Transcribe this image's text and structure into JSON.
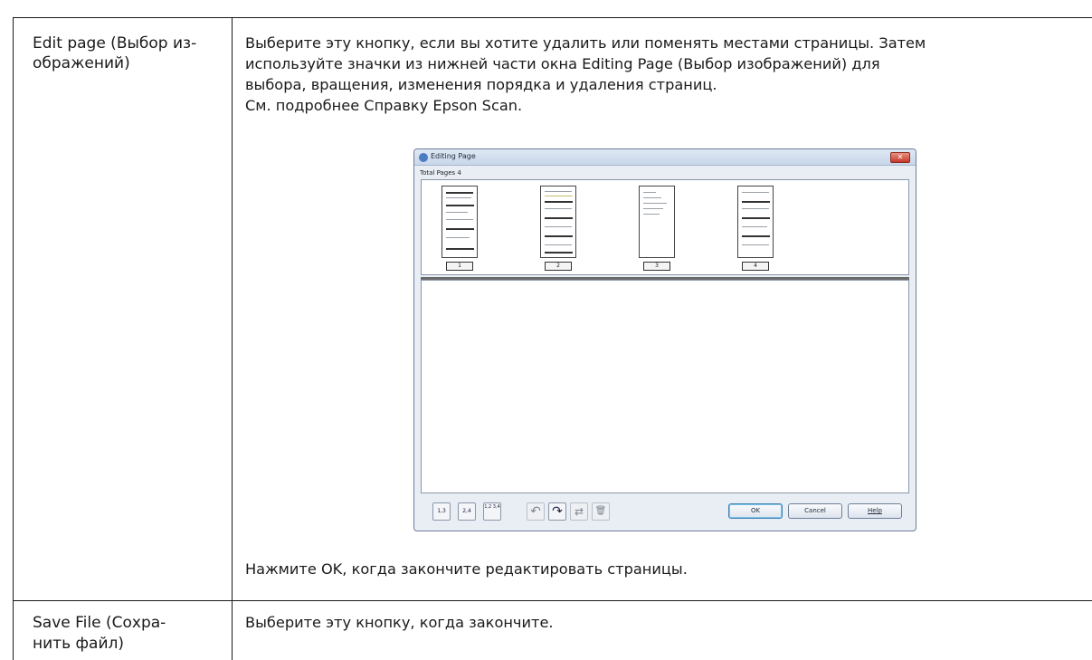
{
  "rows": [
    {
      "left_line1": "Edit page (Выбор из-",
      "left_line2": "ображений)",
      "right_lines": [
        "Выберите эту кнопку, если вы хотите удалить или поменять местами страницы. Затем",
        "используйте значки из нижней части окна Editing Page (Выбор изображений) для",
        "выбора, вращения, изменения порядка и удаления страниц.",
        "См. подробнее Справку Epson Scan."
      ],
      "after_text": "Нажмите OK, когда закончите редактировать страницы."
    },
    {
      "left_line1": "Save File (Сохра-",
      "left_line2": "нить файл)",
      "right_lines": [
        "Выберите эту кнопку, когда закончите."
      ]
    }
  ],
  "dialog": {
    "title": "Editing Page",
    "close_glyph": "✕",
    "total_pages": "Total Pages 4",
    "pages": [
      "1",
      "2",
      "3",
      "4"
    ],
    "toolbar": {
      "odd_pages_icon": "1,3",
      "even_pages_icon": "2,4",
      "all_pages_icon": "1,2 3,4",
      "rotate_left_icon": "↶",
      "rotate_right_icon": "↷",
      "reorder_icon": "⇄",
      "delete_icon": "🗑"
    },
    "buttons": {
      "ok": "OK",
      "cancel": "Cancel",
      "help": "Help"
    }
  }
}
